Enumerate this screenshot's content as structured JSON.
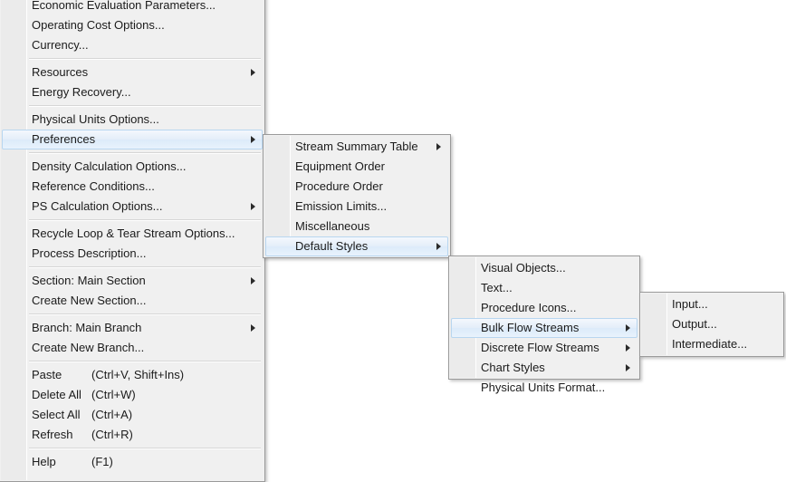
{
  "menus": {
    "main": {
      "name": "edit-menu",
      "groups": [
        {
          "items": [
            {
              "label": "Economic Evaluation Parameters...",
              "arrow": false,
              "selected": false,
              "name": "economic-evaluation-parameters"
            },
            {
              "label": "Operating Cost Options...",
              "arrow": false,
              "selected": false,
              "name": "operating-cost-options"
            },
            {
              "label": "Currency...",
              "arrow": false,
              "selected": false,
              "name": "currency"
            }
          ]
        },
        {
          "items": [
            {
              "label": "Resources",
              "arrow": true,
              "selected": false,
              "name": "resources"
            },
            {
              "label": "Energy Recovery...",
              "arrow": false,
              "selected": false,
              "name": "energy-recovery"
            }
          ]
        },
        {
          "items": [
            {
              "label": "Physical Units Options...",
              "arrow": false,
              "selected": false,
              "name": "physical-units-options"
            },
            {
              "label": "Preferences",
              "arrow": true,
              "selected": true,
              "name": "preferences"
            }
          ]
        },
        {
          "items": [
            {
              "label": "Density Calculation Options...",
              "arrow": false,
              "selected": false,
              "name": "density-calculation-options"
            },
            {
              "label": "Reference Conditions...",
              "arrow": false,
              "selected": false,
              "name": "reference-conditions"
            },
            {
              "label": "PS Calculation Options...",
              "arrow": true,
              "selected": false,
              "name": "ps-calculation-options"
            }
          ]
        },
        {
          "items": [
            {
              "label": "Recycle Loop & Tear Stream Options...",
              "arrow": false,
              "selected": false,
              "name": "recycle-loop-tear-stream-options"
            },
            {
              "label": "Process Description...",
              "arrow": false,
              "selected": false,
              "name": "process-description"
            }
          ]
        },
        {
          "items": [
            {
              "label": "Section: Main Section",
              "arrow": true,
              "selected": false,
              "name": "section-main-section"
            },
            {
              "label": "Create New Section...",
              "arrow": false,
              "selected": false,
              "name": "create-new-section"
            }
          ]
        },
        {
          "items": [
            {
              "label": "Branch: Main Branch",
              "arrow": true,
              "selected": false,
              "name": "branch-main-branch"
            },
            {
              "label": "Create New Branch...",
              "arrow": false,
              "selected": false,
              "name": "create-new-branch"
            }
          ]
        },
        {
          "items": [
            {
              "label": "Paste",
              "shortcut": "(Ctrl+V, Shift+Ins)",
              "arrow": false,
              "selected": false,
              "name": "paste"
            },
            {
              "label": "Delete All",
              "shortcut": "(Ctrl+W)",
              "arrow": false,
              "selected": false,
              "name": "delete-all"
            },
            {
              "label": "Select All",
              "shortcut": "(Ctrl+A)",
              "arrow": false,
              "selected": false,
              "name": "select-all"
            },
            {
              "label": "Refresh",
              "shortcut": "(Ctrl+R)",
              "arrow": false,
              "selected": false,
              "name": "refresh"
            }
          ]
        },
        {
          "items": [
            {
              "label": "Help",
              "shortcut": "(F1)",
              "arrow": false,
              "selected": false,
              "name": "help"
            }
          ]
        }
      ]
    },
    "preferences": {
      "name": "preferences-submenu",
      "groups": [
        {
          "items": [
            {
              "label": "Stream Summary Table",
              "arrow": true,
              "selected": false,
              "name": "stream-summary-table"
            },
            {
              "label": "Equipment Order",
              "arrow": false,
              "selected": false,
              "name": "equipment-order"
            },
            {
              "label": "Procedure Order",
              "arrow": false,
              "selected": false,
              "name": "procedure-order"
            },
            {
              "label": "Emission Limits...",
              "arrow": false,
              "selected": false,
              "name": "emission-limits"
            },
            {
              "label": "Miscellaneous",
              "arrow": false,
              "selected": false,
              "name": "miscellaneous"
            },
            {
              "label": "Default Styles",
              "arrow": true,
              "selected": true,
              "name": "default-styles"
            }
          ]
        }
      ]
    },
    "default_styles": {
      "name": "default-styles-submenu",
      "groups": [
        {
          "items": [
            {
              "label": "Visual Objects...",
              "arrow": false,
              "selected": false,
              "name": "visual-objects"
            },
            {
              "label": "Text...",
              "arrow": false,
              "selected": false,
              "name": "text"
            },
            {
              "label": "Procedure Icons...",
              "arrow": false,
              "selected": false,
              "name": "procedure-icons"
            },
            {
              "label": "Bulk Flow Streams",
              "arrow": true,
              "selected": true,
              "name": "bulk-flow-streams"
            },
            {
              "label": "Discrete Flow Streams",
              "arrow": true,
              "selected": false,
              "name": "discrete-flow-streams"
            },
            {
              "label": "Chart Styles",
              "arrow": true,
              "selected": false,
              "name": "chart-styles"
            },
            {
              "label": "Physical Units Format...",
              "arrow": false,
              "selected": false,
              "name": "physical-units-format"
            }
          ]
        }
      ]
    },
    "bulk_flow_streams": {
      "name": "bulk-flow-streams-submenu",
      "groups": [
        {
          "items": [
            {
              "label": "Input...",
              "arrow": false,
              "selected": false,
              "name": "input"
            },
            {
              "label": "Output...",
              "arrow": false,
              "selected": false,
              "name": "output"
            },
            {
              "label": "Intermediate...",
              "arrow": false,
              "selected": false,
              "name": "intermediate"
            }
          ]
        }
      ]
    }
  },
  "colors": {
    "menu_background": "#f0f0f0",
    "gutter": "#ebebeb",
    "border": "#9a9a9a",
    "highlight_fill": "#dcebfa",
    "highlight_border": "#b8d6f0",
    "text": "#1b1b1b",
    "separator": "#d6d6d6"
  }
}
